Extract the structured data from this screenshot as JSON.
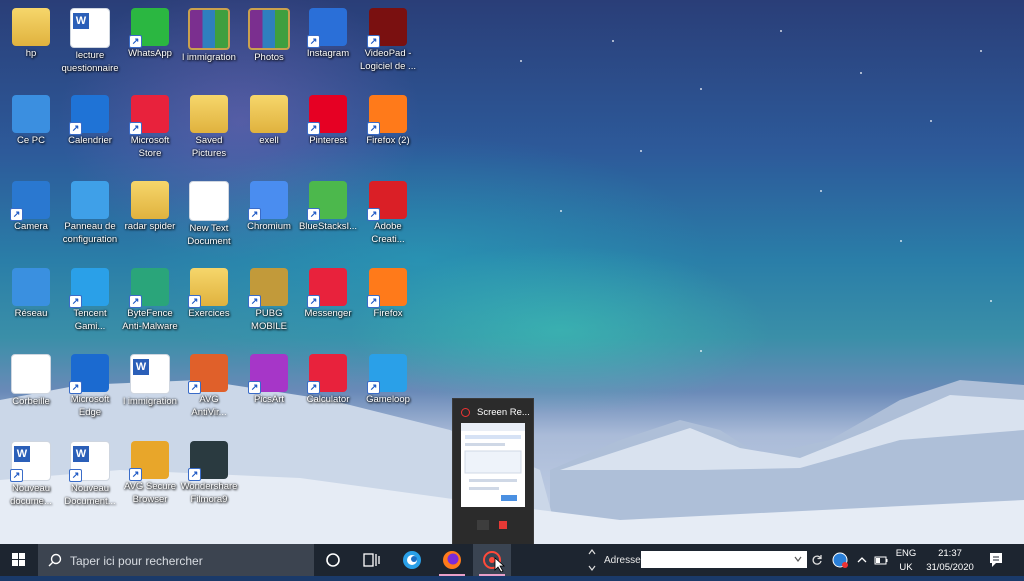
{
  "desktop_icons": [
    {
      "label": "hp"
    },
    {
      "label": "lecture\nquestionnaire"
    },
    {
      "label": "WhatsApp"
    },
    {
      "label": "l immigration"
    },
    {
      "label": "Photos"
    },
    {
      "label": "Instagram"
    },
    {
      "label": "VideoPad -\nLogiciel de ..."
    },
    {
      "label": "Ce PC"
    },
    {
      "label": "Calendrier"
    },
    {
      "label": "Microsoft\nStore"
    },
    {
      "label": "Saved\nPictures"
    },
    {
      "label": "exell"
    },
    {
      "label": "Pinterest"
    },
    {
      "label": "Firefox (2)"
    },
    {
      "label": "Camera"
    },
    {
      "label": "Panneau de\nconfiguration"
    },
    {
      "label": "radar spider"
    },
    {
      "label": "New Text\nDocument"
    },
    {
      "label": "Chromium"
    },
    {
      "label": "BlueStacksI..."
    },
    {
      "label": "Adobe\nCreati..."
    },
    {
      "label": "Réseau"
    },
    {
      "label": "Tencent\nGami..."
    },
    {
      "label": "ByteFence\nAnti-Malware"
    },
    {
      "label": "Exercices"
    },
    {
      "label": "PUBG\nMOBILE"
    },
    {
      "label": "Messenger"
    },
    {
      "label": "Firefox"
    },
    {
      "label": "Corbeille"
    },
    {
      "label": "Microsoft\nEdge"
    },
    {
      "label": "l immigration"
    },
    {
      "label": "AVG\nAntiVir..."
    },
    {
      "label": "PicsArt"
    },
    {
      "label": "Calculator"
    },
    {
      "label": "Gameloop"
    },
    {
      "label": "Nouveau\ndocume..."
    },
    {
      "label": "Nouveau\nDocument..."
    },
    {
      "label": "AVG Secure\nBrowser"
    },
    {
      "label": "Wondershare\nFilmora9"
    }
  ],
  "preview": {
    "title": "Screen Re..."
  },
  "taskbar": {
    "search_placeholder": "Taper ici pour rechercher",
    "address_label": "Adresse",
    "language_top": "ENG",
    "language_bottom": "UK",
    "time": "21:37",
    "date": "31/05/2020"
  }
}
